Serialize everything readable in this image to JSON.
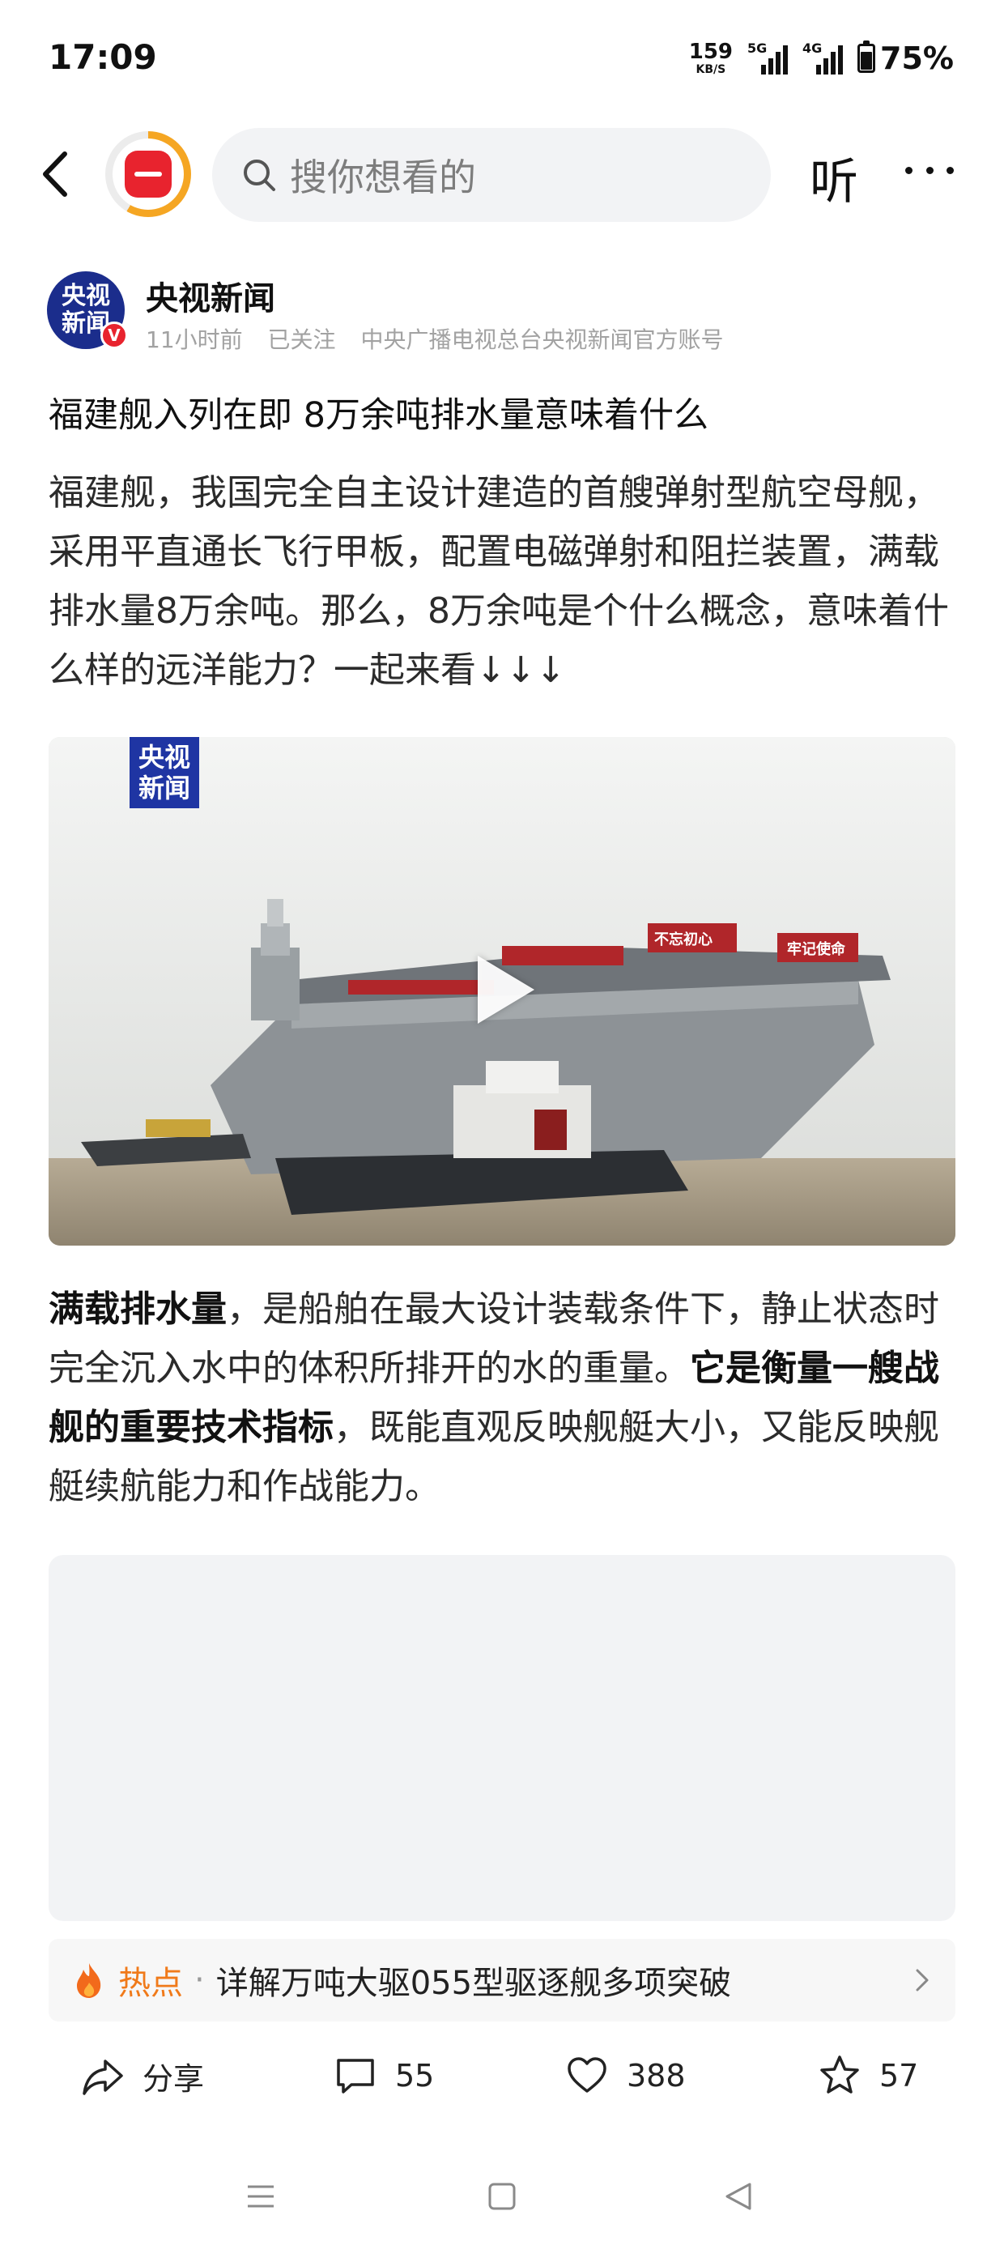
{
  "status_bar": {
    "time": "17:09",
    "net_speed": "159",
    "net_unit": "KB/S",
    "signal1_tag": "5G",
    "signal2_tag": "4G",
    "battery": "75%",
    "battery_level": 0.75
  },
  "nav": {
    "back_icon": "chevron-left-icon",
    "search_placeholder": "搜你想看的",
    "listen_label": "听",
    "more_icon": "more-dots-icon",
    "logo_accent": "#f5a623",
    "logo_brand": "#e8232e"
  },
  "author": {
    "avatar_line1": "央视",
    "avatar_line2": "新闻",
    "verified_mark": "V",
    "name": "央视新闻",
    "time": "11小时前",
    "follow_status": "已关注",
    "description": "中央广播电视总台央视新闻官方账号"
  },
  "article": {
    "title": "福建舰入列在即 8万余吨排水量意味着什么",
    "paragraph1": "福建舰，我国完全自主设计建造的首艘弹射型航空母舰，采用平直通长飞行甲板，配置电磁弹射和阻拦装置，满载排水量8万余吨。那么，8万余吨是个什么概念，意味着什么样的远洋能力？一起来看↓↓↓",
    "video": {
      "logo_line1": "央视",
      "logo_line2": "新闻",
      "banner1": "不忘初心",
      "banner2": "牢记使命"
    },
    "paragraph2_bold1": "满载排水量",
    "paragraph2_text1": "，是船舶在最大设计装载条件下，静止状态时完全沉入水中的体积所排开的水的重量。",
    "paragraph2_bold2": "它是衡量一艘战舰的重要技术指标",
    "paragraph2_text2": "，既能直观反映舰艇大小，又能反映舰艇续航能力和作战能力。"
  },
  "hot": {
    "label": "热点",
    "separator": "·",
    "text": "详解万吨大驱055型驱逐舰多项突破",
    "accent": "#f07a1a"
  },
  "actions": {
    "share_label": "分享",
    "comments": "55",
    "likes": "388",
    "favorites": "57"
  }
}
